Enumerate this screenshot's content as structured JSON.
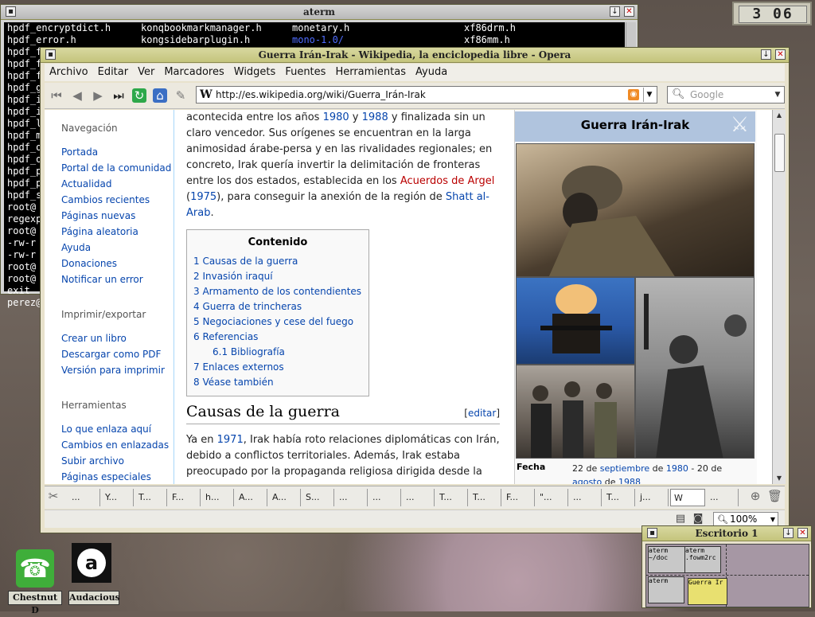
{
  "aterm": {
    "title": "aterm",
    "col1": [
      "hpdf_encryptdict.h",
      "hpdf_error.h",
      "hpdf_f",
      "hpdf_f",
      "hpdf_f",
      "hpdf_g",
      "hpdf_i",
      "hpdf_i",
      "hpdf_l",
      "hpdf_m",
      "hpdf_o",
      "hpdf_o",
      "hpdf_p",
      "hpdf_p",
      "hpdf_s",
      "root@",
      "regexp",
      "root@",
      "-rw-r",
      "-rw-r",
      "root@",
      "root@",
      "exit",
      "perez@"
    ],
    "col2": [
      "konqbookmarkmanager.h",
      "kongsidebarplugin.h"
    ],
    "col3_1": "monetary.h",
    "col3_2": "mono-1.0/",
    "col4": [
      "xf86drm.h",
      "xf86mm.h"
    ]
  },
  "clock": {
    "time": "3 06"
  },
  "opera": {
    "title": "Guerra Irán-Irak - Wikipedia, la enciclopedia libre - Opera",
    "menu": [
      "Archivo",
      "Editar",
      "Ver",
      "Marcadores",
      "Widgets",
      "Fuentes",
      "Herramientas",
      "Ayuda"
    ],
    "url": "http://es.wikipedia.org/wiki/Guerra_Irán-Irak",
    "search_placeholder": "Google",
    "zoom": "100%"
  },
  "sidebar": {
    "nav_heading": "Navegación",
    "nav": [
      "Portada",
      "Portal de la comunidad",
      "Actualidad",
      "Cambios recientes",
      "Páginas nuevas",
      "Página aleatoria",
      "Ayuda",
      "Donaciones",
      "Notificar un error"
    ],
    "print_heading": "Imprimir/exportar",
    "print": [
      "Crear un libro",
      "Descargar como PDF",
      "Versión para imprimir"
    ],
    "tools_heading": "Herramientas",
    "tools": [
      "Lo que enlaza aquí",
      "Cambios en enlazadas",
      "Subir archivo",
      "Páginas especiales"
    ]
  },
  "article": {
    "intro_1": "acontecida entre los años ",
    "y1980": "1980",
    "and": " y ",
    "y1988": "1988",
    "intro_2": " y finalizada sin un claro vencedor. Sus orígenes se encuentran en la larga animosidad árabe-persa y en las rivalidades regionales; en concreto, Irak quería invertir la delimitación de fronteras entre los dos estados, establecida en los ",
    "acuerdos": "Acuerdos de Argel",
    "paren_open": " (",
    "y1975": "1975",
    "intro_3": "), para conseguir la anexión de la región de ",
    "shatt": "Shatt al-Arab",
    "dot": ".",
    "toc_title": "Contenido",
    "toc": [
      "1 Causas de la guerra",
      "2 Invasión iraquí",
      "3 Armamento de los contendientes",
      "4 Guerra de trincheras",
      "5 Negociaciones y cese del fuego",
      "6 Referencias",
      "6.1 Bibliografía",
      "7 Enlaces externos",
      "8 Véase también"
    ],
    "h2": "Causas de la guerra",
    "edit_open": "[",
    "edit": "editar",
    "edit_close": "]",
    "p2_a": "Ya en ",
    "y1971": "1971",
    "p2_b": ", Irak había roto relaciones diplomáticas con Irán, debido a conflictos territoriales. Además, Irak estaba preocupado por la propaganda religiosa dirigida desde la"
  },
  "infobox": {
    "title": "Guerra Irán-Irak",
    "fecha_label": "Fecha",
    "fecha_a": "22 de ",
    "sept": "septiembre",
    "de": " de ",
    "f1980": "1980",
    "fecha_b": " - 20 de ",
    "agosto": "agosto",
    "de2": " de ",
    "f1988": "1988"
  },
  "tabs": [
    "...",
    "Y...",
    "T...",
    "F...",
    "h...",
    "A...",
    "A...",
    "S...",
    "...",
    "...",
    "...",
    "T...",
    "T...",
    "F...",
    "\"...",
    "...",
    "T...",
    "j...",
    "W",
    "..."
  ],
  "pager": {
    "title": "Escritorio 1",
    "mini": [
      "aterm",
      "~/doc",
      "aterm",
      ".fowm2rc",
      "aterm",
      "Guerra Ir"
    ]
  },
  "dock": {
    "phone_label": "Chestnut D",
    "audacious_label": "Audacious"
  }
}
